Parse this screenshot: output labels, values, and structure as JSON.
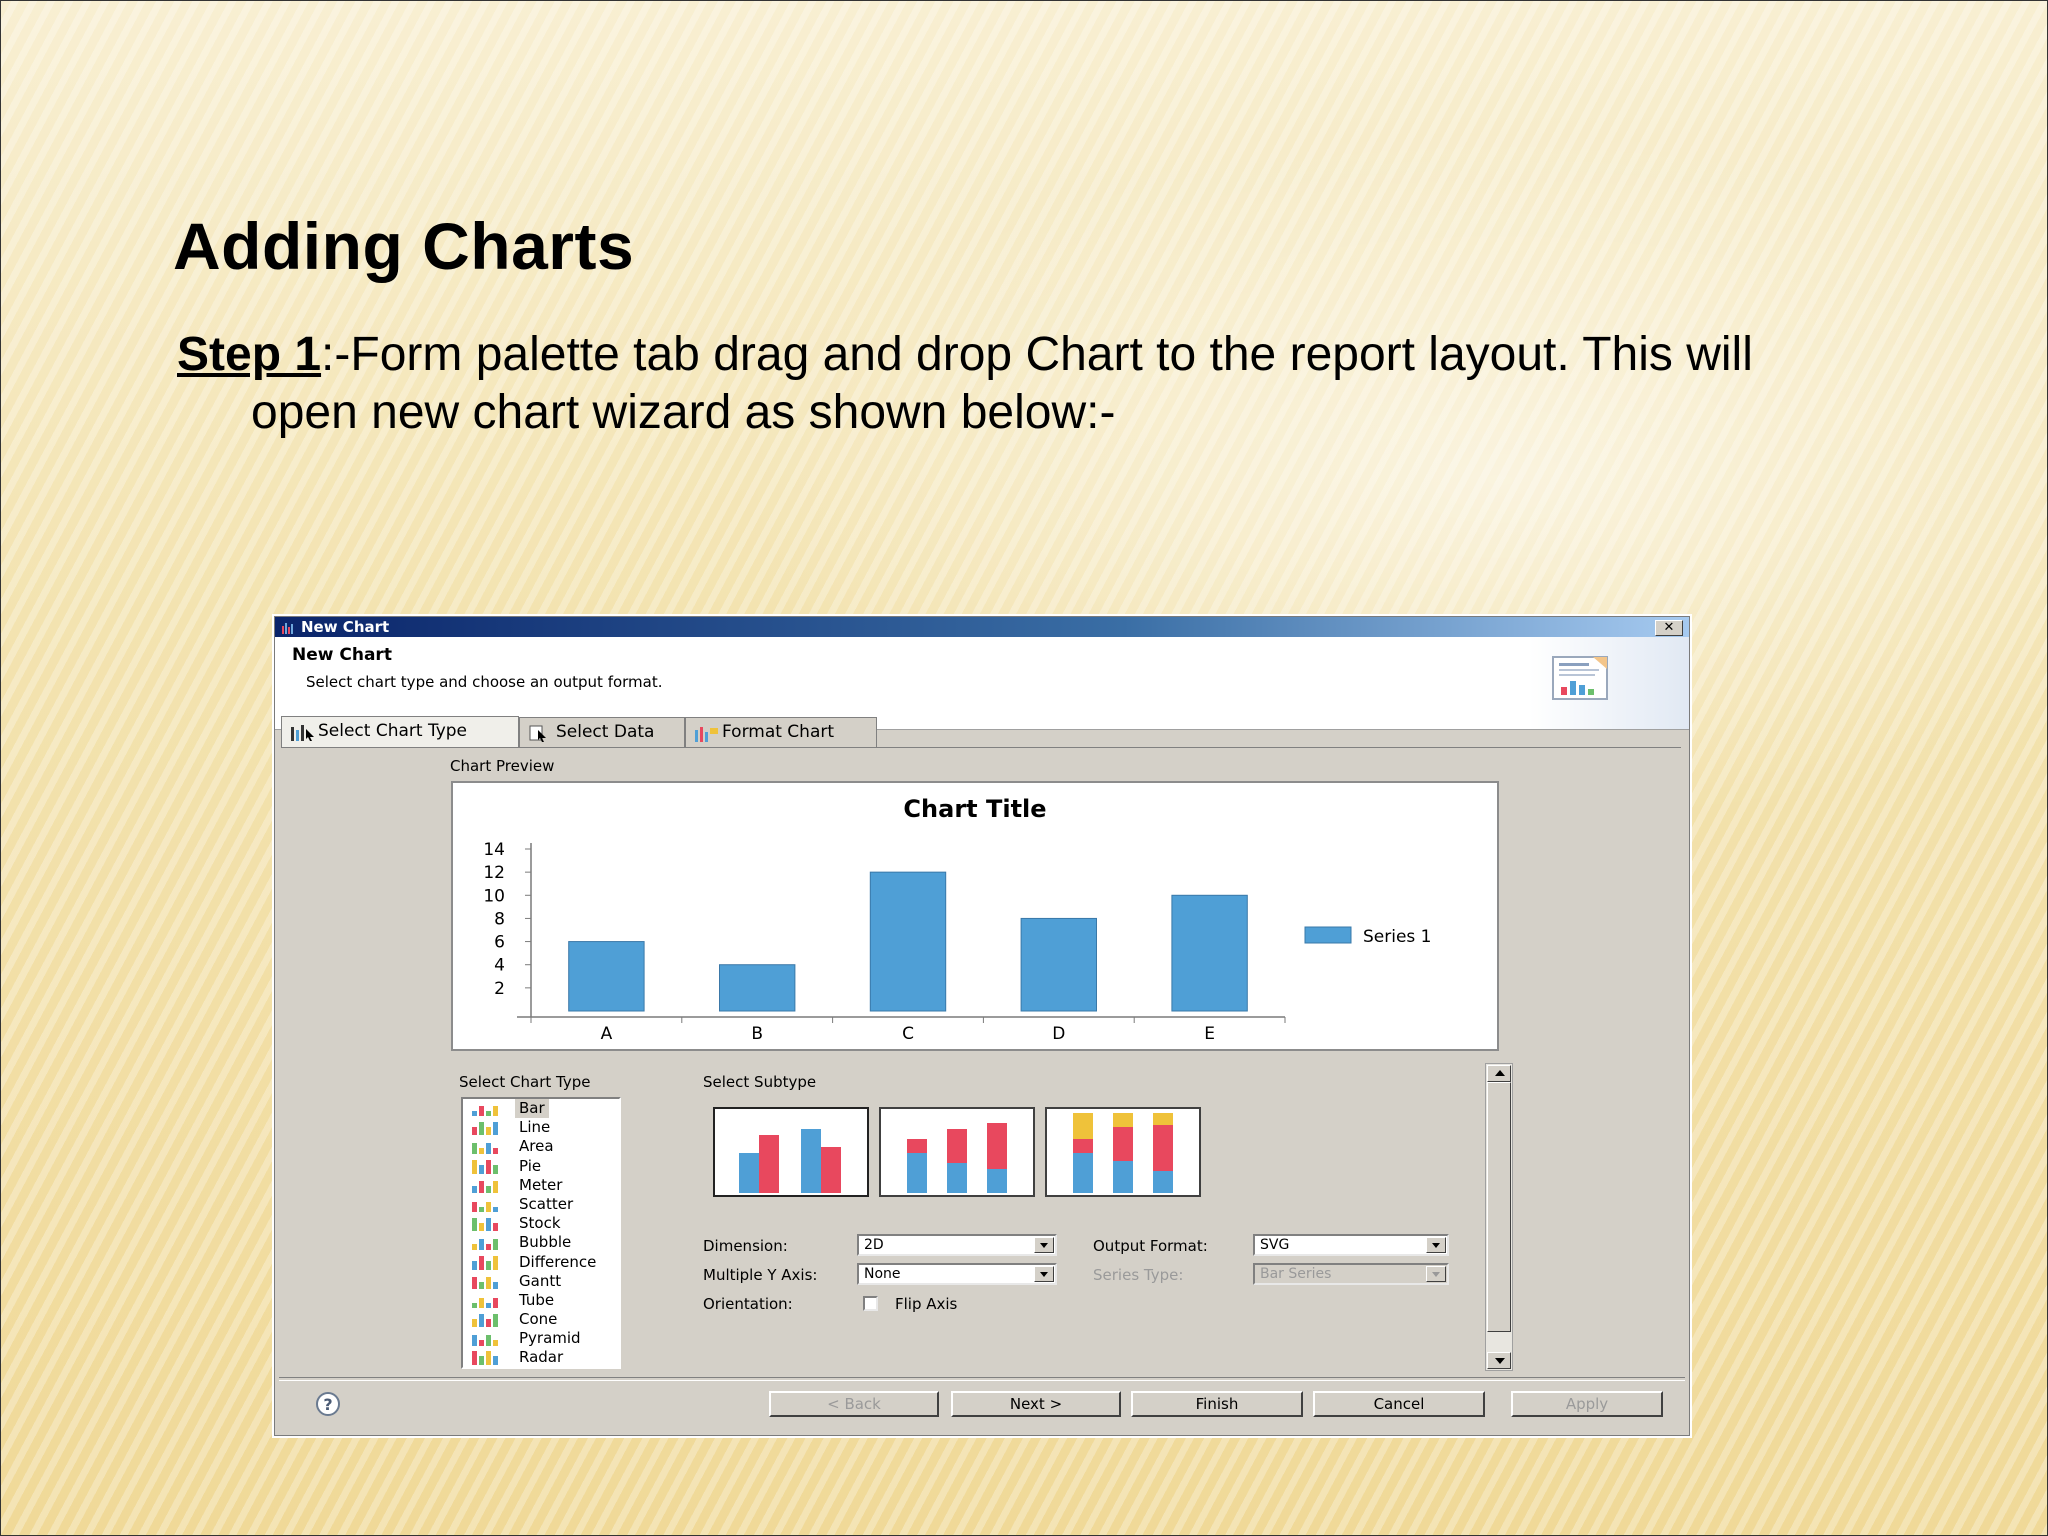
{
  "slide": {
    "title": "Adding Charts",
    "step_label": "Step 1",
    "step_text_line1": ":-Form palette tab drag and drop Chart to the report layout. This will",
    "step_text_line2": "open new chart wizard as shown below:-"
  },
  "dialog": {
    "window_title": "New Chart",
    "header_title": "New Chart",
    "header_subtitle": "Select chart type and choose an output format.",
    "tabs": [
      "Select Chart Type",
      "Select Data",
      "Format Chart"
    ],
    "active_tab": "Select Chart Type",
    "chart_preview_label": "Chart Preview",
    "select_chart_type_label": "Select Chart Type",
    "select_subtype_label": "Select Subtype",
    "chart_types": [
      "Bar",
      "Line",
      "Area",
      "Pie",
      "Meter",
      "Scatter",
      "Stock",
      "Bubble",
      "Difference",
      "Gantt",
      "Tube",
      "Cone",
      "Pyramid",
      "Radar"
    ],
    "selected_chart_type": "Bar",
    "subtypes": [
      "side-by-side",
      "stacked",
      "percent-stacked"
    ],
    "fields": {
      "dimension_label": "Dimension:",
      "dimension_value": "2D",
      "multiple_y_label": "Multiple Y Axis:",
      "multiple_y_value": "None",
      "orientation_label": "Orientation:",
      "flip_axis_label": "Flip Axis",
      "flip_axis_checked": false,
      "output_format_label": "Output Format:",
      "output_format_value": "SVG",
      "series_type_label": "Series Type:",
      "series_type_value": "Bar Series"
    },
    "buttons": {
      "back": "< Back",
      "next": "Next >",
      "finish": "Finish",
      "cancel": "Cancel",
      "apply": "Apply"
    }
  },
  "chart_data": {
    "type": "bar",
    "title": "Chart Title",
    "categories": [
      "A",
      "B",
      "C",
      "D",
      "E"
    ],
    "series": [
      {
        "name": "Series 1",
        "values": [
          6,
          4,
          12,
          8,
          10
        ],
        "color": "#4f9fd6"
      }
    ],
    "yticks": [
      2,
      4,
      6,
      8,
      10,
      12,
      14
    ],
    "ylim": [
      0,
      14
    ],
    "legend_position": "right",
    "grid": false
  },
  "colors": {
    "bar_fill": "#4f9fd6",
    "bar_red": "#e8485e",
    "bar_yellow": "#efc23a",
    "titlebar": "#0a246a"
  }
}
